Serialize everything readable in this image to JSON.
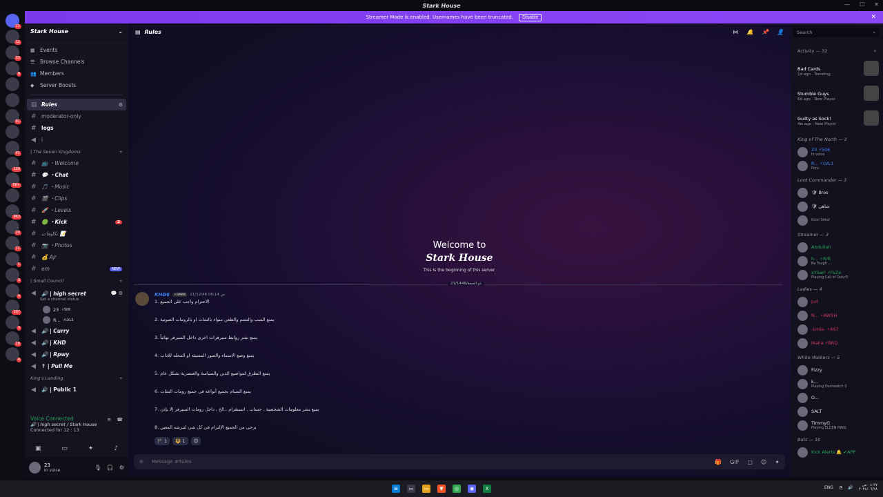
{
  "window": {
    "title": "Stark House"
  },
  "banner": {
    "text": "Streamer Mode is enabled. Usernames have been truncated.",
    "button": "Disable"
  },
  "servers": [
    {
      "badge": "11"
    },
    {
      "badge": "12"
    },
    {
      "badge": "33"
    },
    {
      "badge": "8"
    },
    {
      "badge": ""
    },
    {
      "badge": ""
    },
    {
      "badge": "61"
    },
    {
      "badge": ""
    },
    {
      "badge": "41"
    },
    {
      "badge": "120"
    },
    {
      "badge": "5K+"
    },
    {
      "badge": ""
    },
    {
      "badge": "963"
    },
    {
      "badge": "20"
    },
    {
      "badge": "11"
    },
    {
      "badge": "1"
    },
    {
      "badge": "3"
    },
    {
      "badge": "4"
    },
    {
      "badge": "107"
    },
    {
      "badge": "3"
    },
    {
      "badge": "18"
    },
    {
      "badge": "4"
    }
  ],
  "sidebar": {
    "guild_name": "Stark House",
    "menu": [
      {
        "label": "Events"
      },
      {
        "label": "Browse Channels"
      },
      {
        "label": "Members"
      },
      {
        "label": "Server Boosts"
      }
    ],
    "channels_top": [
      {
        "name": "Rules"
      },
      {
        "name": "moderator-only"
      },
      {
        "name": "logs"
      },
      {
        "name": "i"
      }
    ],
    "cat1": "| The Seven Kingdoms",
    "channels_cat1": [
      {
        "name": "📺 ・Welcome"
      },
      {
        "name": "💬 ・Chat"
      },
      {
        "name": "🎵 ・Music"
      },
      {
        "name": "🎬 ・Clips"
      },
      {
        "name": "🚀 ・Levels"
      },
      {
        "name": "🟢 ・Kick",
        "badge": "2"
      },
      {
        "name": "تكليفات 📝"
      },
      {
        "name": "📷 ・Photos"
      },
      {
        "name": "💰 Ajr"
      },
      {
        "name": "em",
        "new": "NEW"
      }
    ],
    "cat2": "| Small Council",
    "voice_channel": "🔊 | high secret",
    "voice_status": "Set a channel status",
    "voice_users": [
      {
        "name": "23",
        "tag": "⚡506"
      },
      {
        "name": "R...",
        "tag": "⚡LVL1"
      }
    ],
    "channels_cat2": [
      {
        "name": "🔊 | Curry"
      },
      {
        "name": "🔊 | KHD"
      },
      {
        "name": "🔊 | Rpwy"
      },
      {
        "name": "↑ | Pull Me"
      }
    ],
    "cat3": "King's Landing",
    "channels_cat3": [
      {
        "name": "🔊 | Public 1"
      }
    ],
    "voice": {
      "connected": "Voice Connected",
      "where": "🔊 | high secret / Stark House",
      "time": "Connected for 12 : 13"
    },
    "user": {
      "name": "23",
      "status": "In voice"
    }
  },
  "header": {
    "channel": "Rules",
    "search_placeholder": "Search"
  },
  "welcome": {
    "line1": "Welcome to",
    "line2": "Stark House",
    "line3": "This is the beginning of this server."
  },
  "date_divider": "21/1446/ذو الحجة",
  "message": {
    "author": "KHD6",
    "tag": "⚡DARK",
    "timestamp": "21/12/46 06:14 ص",
    "lines": [
      "1. الاحترام واجب على الجميع",
      "2. يمنع السب والشتم والطعن سواء بالشات او بالرومات الصوتية",
      "3. يمنع نشر روابط سيرفرات اخرى داخل السيرفر نهائياً",
      "4. يمنع وضع الاسماء والصور  المسيئه او المخله للاداب",
      "5. يمنع التطرق لمواضيع الدين والسياسة والعنصرية بشكل عام",
      "6. يمنع السبام بجميع أنواعه في جميع رومات الشات",
      "7. يمنع نشر معلومات الشخصية , حساب , انستقرام ..الخ , داخل رومات السيرفر إلا بإذن",
      "8. يرجى من الجميع الإلتزام في كل شي لتترشه المعين"
    ],
    "reactions": [
      {
        "emoji": "🏴",
        "count": "1"
      },
      {
        "emoji": "🔱",
        "count": "1"
      }
    ]
  },
  "composer": {
    "placeholder": "Message #Rules"
  },
  "members": {
    "activity_header": "Activity — 32",
    "activities": [
      {
        "title": "Bad Cards",
        "meta": "1d ago  ·  Trending"
      },
      {
        "title": "Stumble Guys",
        "meta": "6d ago  ·  New Player"
      },
      {
        "title": "Guilty as Sock!",
        "meta": "4w ago  ·  New Player"
      }
    ],
    "groups": [
      {
        "title": "King of The North — 2",
        "users": [
          {
            "name": "23 ⚡506",
            "sub": "In voice",
            "color": "#3b82f6"
          },
          {
            "name": "R... ⚡LVL1",
            "sub": "Pero",
            "color": "#3b82f6"
          }
        ]
      },
      {
        "title": "Lord Commander — 3",
        "users": [
          {
            "name": "🛡 Bros",
            "sub": "",
            "color": "#dbdee1"
          },
          {
            "name": "🛡 شاهي",
            "sub": "",
            "color": "#dbdee1"
          },
          {
            "name": "",
            "sub": "Kick/ Shtaf",
            "color": "#dbdee1"
          }
        ]
      },
      {
        "title": "Streamer — 3",
        "users": [
          {
            "name": "Abdullah",
            "sub": "",
            "color": "#23a55a"
          },
          {
            "name": "h... ⚡R/R",
            "sub": "Be Tough ...",
            "color": "#23a55a"
          },
          {
            "name": "xY5wF ⚡FaZe",
            "sub": "Playing Call of Duty®",
            "color": "#23a55a"
          }
        ]
      },
      {
        "title": "Ladies — 4",
        "users": [
          {
            "name": "Juri",
            "sub": "",
            "color": "#d1395e"
          },
          {
            "name": "N... ⚡AWSH",
            "sub": "",
            "color": "#d1395e"
          },
          {
            "name": "-Lmla- ⚡AS7",
            "sub": "",
            "color": "#d1395e"
          },
          {
            "name": "Maha ⚡BRQ",
            "sub": "",
            "color": "#d1395e"
          }
        ]
      },
      {
        "title": "White Walkers — 5",
        "users": [
          {
            "name": "Fizzy",
            "sub": "",
            "color": "#dbdee1"
          },
          {
            "name": "k...",
            "sub": "Playing Overwatch 2",
            "color": "#dbdee1"
          },
          {
            "name": "O...",
            "sub": "",
            "color": "#dbdee1"
          },
          {
            "name": "SALT",
            "sub": "",
            "color": "#dbdee1"
          },
          {
            "name": "TimmyG",
            "sub": "Playing ELDEN RING",
            "color": "#dbdee1"
          }
        ]
      },
      {
        "title": "Bots — 10",
        "users": [
          {
            "name": "Kick Alerts 🔔 ✔APP",
            "sub": "",
            "color": "#23a55a"
          }
        ]
      }
    ]
  },
  "taskbar": {
    "lang": "ENG",
    "time": "٠٤:٢٧ ص",
    "date": "٢٠٢٤/٠٦/٢٨"
  }
}
